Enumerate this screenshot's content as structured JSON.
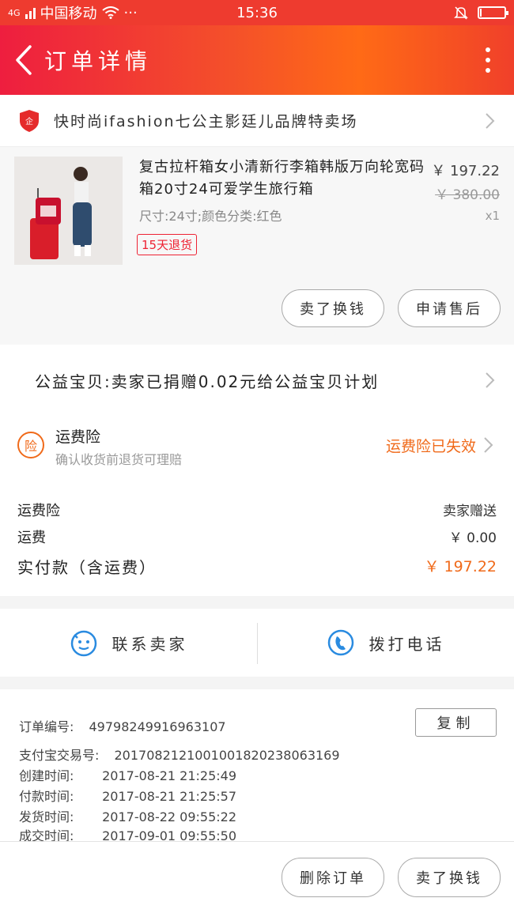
{
  "status_bar": {
    "network": "4G",
    "carrier": "中国移动",
    "dots": "···",
    "time": "15:36",
    "battery_level": 0.08
  },
  "header": {
    "title": "订单详情"
  },
  "shop": {
    "name": "快时尚ifashion七公主影廷儿品牌特卖场"
  },
  "product": {
    "title": "复古拉杆箱女小清新行李箱韩版万向轮宽码箱20寸24可爱学生旅行箱",
    "spec": "尺寸:24寸;颜色分类:红色",
    "return_badge": "15天退货",
    "price": "￥ 197.22",
    "old_price": "￥ 380.00",
    "quantity": "x1",
    "buttons": {
      "sell_label": "卖了换钱",
      "aftersale_label": "申请售后"
    }
  },
  "charity": {
    "text": "公益宝贝:卖家已捐赠0.02元给公益宝贝计划"
  },
  "insurance": {
    "icon_text": "险",
    "title": "运费险",
    "subtitle": "确认收货前退货可理赔",
    "status": "运费险已失效"
  },
  "costs": {
    "rows": [
      {
        "label": "运费险",
        "value": "卖家赠送"
      },
      {
        "label": "运费",
        "value": "￥ 0.00"
      }
    ],
    "total_label": "实付款（含运费）",
    "total_value": "￥ 197.22"
  },
  "contact": {
    "seller_label": "联系卖家",
    "phone_label": "拨打电话"
  },
  "order_info": {
    "copy_label": "复制",
    "rows": [
      {
        "key": "订单编号:",
        "value": "49798249916963107"
      },
      {
        "key": "支付宝交易号:",
        "value": "2017082121001001820238063169"
      },
      {
        "key": "创建时间:",
        "value": "2017-08-21 21:25:49"
      },
      {
        "key": "付款时间:",
        "value": "2017-08-21 21:25:57"
      },
      {
        "key": "发货时间:",
        "value": "2017-08-22 09:55:22"
      },
      {
        "key": "成交时间:",
        "value": "2017-09-01 09:55:50"
      }
    ]
  },
  "bottom_bar": {
    "delete_label": "删除订单",
    "sell_label": "卖了换钱"
  },
  "colors": {
    "brand_red": "#ee3b2f",
    "accent_orange": "#f06a1a"
  }
}
